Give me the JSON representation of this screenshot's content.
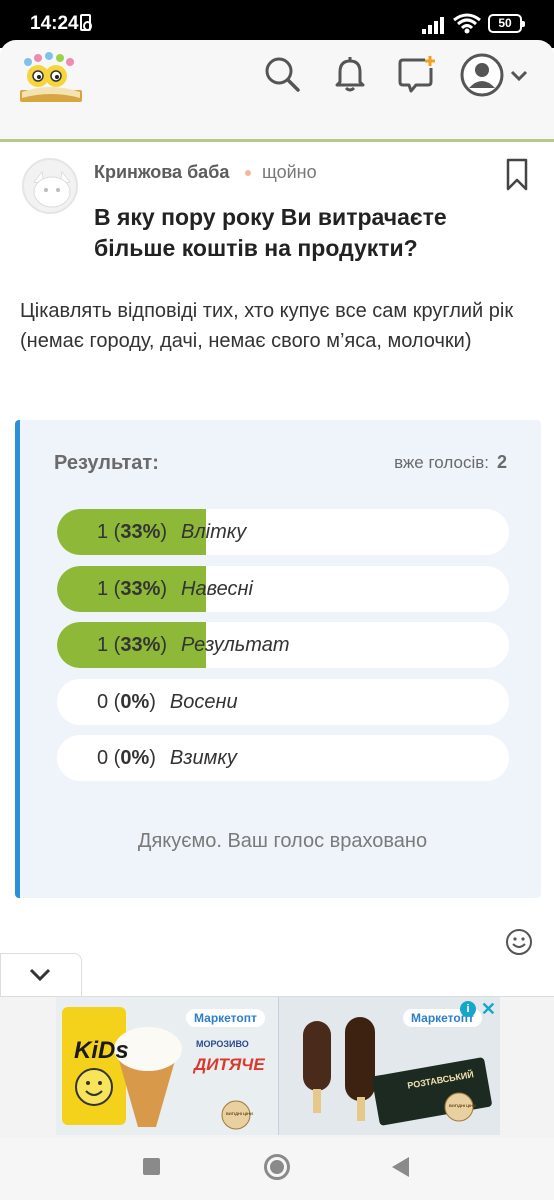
{
  "status_bar": {
    "time": "14:24",
    "battery": "50"
  },
  "post": {
    "author": "Кринжова баба",
    "time": "щойно",
    "title": "В яку пору року Ви витрачаєте більше коштів на продукти?",
    "body": "Цікавлять відповіді тих, хто купує все сам круглий рік (немає городу, дачі, немає свого м’яса, молочки)"
  },
  "poll": {
    "title": "Результат:",
    "votes_label": "вже голосів:",
    "votes_count": "2",
    "options": [
      {
        "count": "1",
        "percent": "33%",
        "label": "Влітку",
        "fraction": 0.33
      },
      {
        "count": "1",
        "percent": "33%",
        "label": "Навесні",
        "fraction": 0.33
      },
      {
        "count": "1",
        "percent": "33%",
        "label": "Результат",
        "fraction": 0.33
      },
      {
        "count": "0",
        "percent": "0%",
        "label": "Восени",
        "fraction": 0
      },
      {
        "count": "0",
        "percent": "0%",
        "label": "Взимку",
        "fraction": 0
      }
    ],
    "thanks": "Дякуємо. Ваш голос враховано"
  },
  "ad": {
    "brand_left": "Маркетопт",
    "product_left_small": "МОРОЗИВО",
    "product_left": "ДИТЯЧЕ",
    "brand_right": "Маркетопт",
    "kids_logo": "KiDs",
    "right_pack": "РОЗТАВСЬКИЙ",
    "stamp": "ВИГІДНІ ЦІНИ"
  },
  "colors": {
    "accent": "#2d8fd8",
    "bar_fill": "#8db838",
    "poll_bg": "#eef4f9",
    "header_line": "#b9c98e"
  },
  "icons": [
    "search-icon",
    "bell-icon",
    "add-post-icon",
    "user-avatar-icon",
    "chevron-down-icon",
    "bookmark-icon",
    "emoji-icon"
  ]
}
